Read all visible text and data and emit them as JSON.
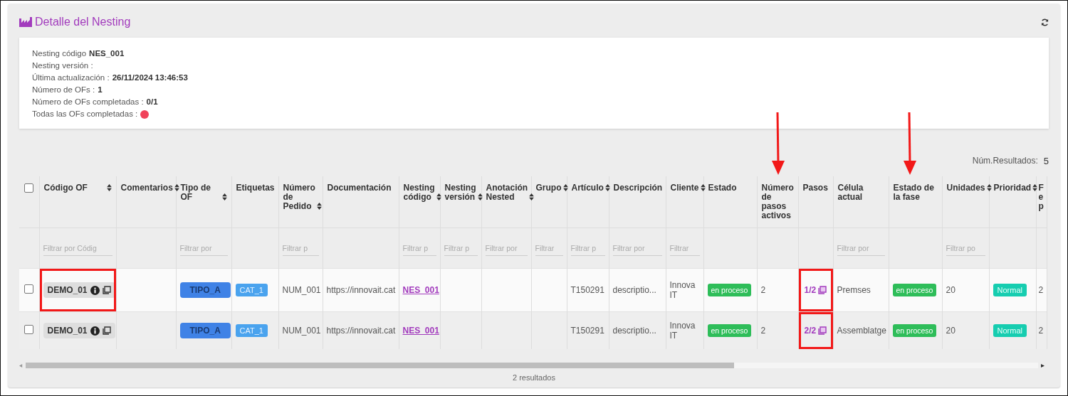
{
  "title": "Detalle del Nesting",
  "info": [
    {
      "label": "Nesting código",
      "value": "NES_001"
    },
    {
      "label": "Nesting versión :"
    },
    {
      "label": "Última actualización :",
      "value": "26/11/2024 13:46:53"
    },
    {
      "label": "Número de OFs :",
      "value": "1"
    },
    {
      "label": "Número de OFs completadas :",
      "value": "0/1"
    },
    {
      "label": "Todas las OFs completadas :",
      "done": false
    }
  ],
  "results": {
    "label": "Núm.Resultados:",
    "value": "5"
  },
  "table": {
    "select_all": {
      "checked": false
    },
    "columns": [
      {
        "label": "Código OF",
        "sortable": true,
        "placeholder": "Filtrar por Códig",
        "arrow": false
      },
      {
        "label": "Comentarios",
        "sortable": true,
        "arrow": false
      },
      {
        "label": "Tipo de OF",
        "sortable": true,
        "placeholder": "Filtrar por",
        "arrow": false
      },
      {
        "label": "Etiquetas",
        "sortable": false,
        "arrow": false
      },
      {
        "label": "Número de Pedido",
        "sortable": true,
        "placeholder": "Filtrar p",
        "arrow": false
      },
      {
        "label": "Documentación",
        "sortable": false,
        "arrow": false
      },
      {
        "label": "Nesting código",
        "sortable": true,
        "placeholder": "Filtrar p",
        "arrow": false
      },
      {
        "label": "Nesting versión",
        "sortable": true,
        "placeholder": "Filtrar p",
        "arrow": false
      },
      {
        "label": "Anotación Nested",
        "sortable": true,
        "placeholder": "Filtrar por",
        "arrow": false
      },
      {
        "label": "Grupo",
        "sortable": true,
        "placeholder": "Filtrar",
        "arrow": false
      },
      {
        "label": "Artículo",
        "sortable": true,
        "placeholder": "Filtrar p",
        "arrow": false
      },
      {
        "label": "Descripción",
        "sortable": false,
        "placeholder": "Filtrar por",
        "arrow": false
      },
      {
        "label": "Cliente",
        "sortable": true,
        "placeholder": "Filtrar",
        "arrow": false
      },
      {
        "label": "Estado",
        "sortable": false,
        "arrow": false
      },
      {
        "label": "Número de pasos activos",
        "sortable": false,
        "arrow": true
      },
      {
        "label": "Pasos",
        "sortable": false,
        "arrow": false
      },
      {
        "label": "Célula actual",
        "sortable": false,
        "placeholder": "Filtrar por",
        "arrow": false
      },
      {
        "label": "Estado de la fase",
        "sortable": false,
        "arrow": true
      },
      {
        "label": "Unidades",
        "sortable": true,
        "placeholder": "Filtrar po",
        "arrow": false
      },
      {
        "label": "Prioridad",
        "sortable": true,
        "arrow": false
      },
      {
        "label": "F e p",
        "sortable": false,
        "arrow": false
      }
    ],
    "rows": [
      {
        "checked": false,
        "cells": [
          {
            "kind": "code",
            "text": "DEMO_01",
            "highlighted": true
          },
          {
            "kind": "empty"
          },
          {
            "kind": "type",
            "text": "TIPO_A"
          },
          {
            "kind": "tag",
            "text": "CAT_1"
          },
          {
            "kind": "text",
            "text": "NUM_001"
          },
          {
            "kind": "text",
            "text": "https://innovait.cat"
          },
          {
            "kind": "link",
            "text": "NES_001"
          },
          {
            "kind": "empty"
          },
          {
            "kind": "empty"
          },
          {
            "kind": "empty"
          },
          {
            "kind": "text",
            "text": "T150291"
          },
          {
            "kind": "text",
            "text": "descriptio..."
          },
          {
            "kind": "text",
            "text": "Innova IT"
          },
          {
            "kind": "status",
            "text": "en proceso"
          },
          {
            "kind": "text",
            "text": "2"
          },
          {
            "kind": "steps",
            "text": "1/2",
            "highlighted": true
          },
          {
            "kind": "text",
            "text": "Premses"
          },
          {
            "kind": "status",
            "text": "en proceso"
          },
          {
            "kind": "text",
            "text": "20"
          },
          {
            "kind": "priority",
            "text": "Normal"
          },
          {
            "kind": "text",
            "text": "2"
          }
        ]
      },
      {
        "checked": false,
        "cells": [
          {
            "kind": "code",
            "text": "DEMO_01",
            "highlighted": false
          },
          {
            "kind": "empty"
          },
          {
            "kind": "type",
            "text": "TIPO_A"
          },
          {
            "kind": "tag",
            "text": "CAT_1"
          },
          {
            "kind": "text",
            "text": "NUM_001"
          },
          {
            "kind": "text",
            "text": "https://innovait.cat"
          },
          {
            "kind": "link",
            "text": "NES_001"
          },
          {
            "kind": "empty"
          },
          {
            "kind": "empty"
          },
          {
            "kind": "empty"
          },
          {
            "kind": "text",
            "text": "T150291"
          },
          {
            "kind": "text",
            "text": "descriptio..."
          },
          {
            "kind": "text",
            "text": "Innova IT"
          },
          {
            "kind": "status",
            "text": "en proceso"
          },
          {
            "kind": "text",
            "text": "2"
          },
          {
            "kind": "steps",
            "text": "2/2",
            "highlighted": true
          },
          {
            "kind": "text",
            "text": "Assemblatge"
          },
          {
            "kind": "status",
            "text": "en proceso"
          },
          {
            "kind": "text",
            "text": "20"
          },
          {
            "kind": "priority",
            "text": "Normal"
          },
          {
            "kind": "text",
            "text": "2"
          }
        ]
      }
    ]
  },
  "footer": "2 resultados"
}
